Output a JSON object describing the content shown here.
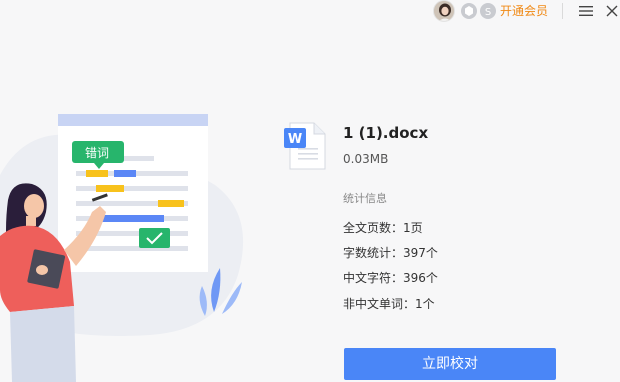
{
  "titlebar": {
    "vip_label": "开通会员",
    "icons": [
      "avatar",
      "badge-icon",
      "coin-icon",
      "menu-icon",
      "close-icon"
    ]
  },
  "illustration": {
    "tag_label": "错词",
    "colors": {
      "tag": "#27b56c",
      "check": "#27b56c",
      "highlight_yellow": "#f8c21c",
      "highlight_blue": "#5b87f6",
      "shirt": "#ee5f5b"
    }
  },
  "file": {
    "name": "1 (1).docx",
    "size": "0.03MB",
    "icon": "word-doc-icon"
  },
  "stats": {
    "title": "统计信息",
    "rows": [
      {
        "label": "全文页数：",
        "value": "1页"
      },
      {
        "label": "字数统计：",
        "value": "397个"
      },
      {
        "label": "中文字符：",
        "value": "396个"
      },
      {
        "label": "非中文单词：",
        "value": "1个"
      }
    ]
  },
  "actions": {
    "check_label": "立即校对",
    "accent": "#4a86f7"
  }
}
